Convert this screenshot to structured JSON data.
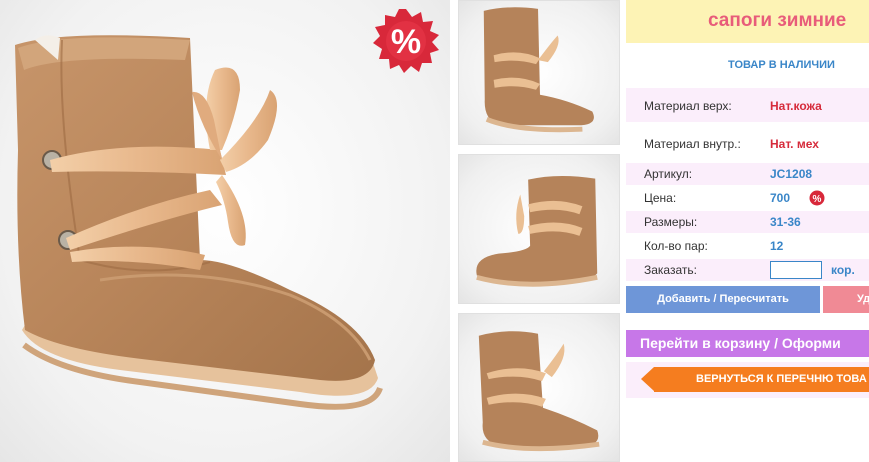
{
  "product": {
    "title": "сапоги зимние",
    "stock_status": "ТОВАР В НАЛИЧИИ",
    "sale_badge": "%",
    "price_badge": "%",
    "colors": {
      "title_bg": "#fdf3b5",
      "title_text": "#e85c7a",
      "accent_blue": "#3a86c8",
      "accent_red": "#d62b3b",
      "row_pink": "#fbeefb"
    }
  },
  "specs": {
    "material_top_label": "Материал верх:",
    "material_top_value": "Нат.кожа",
    "material_inner_label": "Материал внутр.:",
    "material_inner_value": "Нат. мех",
    "article_label": "Артикул:",
    "article_value": "JC1208",
    "price_label": "Цена:",
    "price_value": "700",
    "sizes_label": "Размеры:",
    "sizes_value": "31-36",
    "pairs_label": "Кол-во пар:",
    "pairs_value": "12",
    "order_label": "Заказать:",
    "order_value": "",
    "order_unit": "кор."
  },
  "actions": {
    "add_label": "Добавить / Пересчитать",
    "delete_label": "Уд",
    "cart_label": "Перейти в корзину / Оформи",
    "back_label": "ВЕРНУТЬСЯ К ПЕРЕЧНЮ ТОВА",
    "add_color": "#6e96d8",
    "delete_color": "#f08a95",
    "cart_color": "#c777e8",
    "back_color": "#f57d1f"
  },
  "gallery": {
    "main_image": "boot-photo",
    "thumbnails": [
      "boot-thumb-side",
      "boot-thumb-front",
      "boot-thumb-angle"
    ]
  }
}
